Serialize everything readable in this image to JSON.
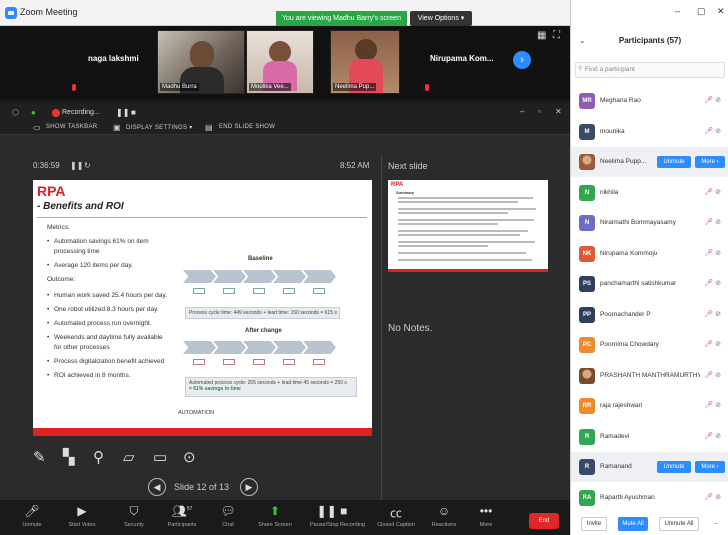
{
  "window": {
    "title": "Zoom Meeting"
  },
  "banner": {
    "sharing_text": "You are viewing Madhu Barry's screen",
    "view_options": "View Options ▾"
  },
  "strip": {
    "tiles": [
      {
        "name": "naga lakshmi"
      },
      {
        "name": "Madhu Burra"
      },
      {
        "name": "Moulika Vee..."
      },
      {
        "name": "Neelima Pup..."
      },
      {
        "name": "Nirupama Kom..."
      }
    ]
  },
  "sharebar": {
    "recording": "Recording...",
    "show_taskbar": "SHOW TASKBAR",
    "display_settings": "DISPLAY SETTINGS ▾",
    "end_slideshow": "END SLIDE SHOW"
  },
  "presenter": {
    "timer": "0:36:59",
    "clock": "8:52 AM",
    "next_slide_label": "Next slide",
    "no_notes": "No Notes.",
    "slide_counter": "Slide 12 of 13"
  },
  "slide": {
    "title": "RPA",
    "subtitle": "- Benefits and ROI",
    "metrics_label": "Metrics:",
    "metrics": [
      "Automation savings 61% on item",
      "processing time",
      "Average 120 items per day."
    ],
    "outcome_label": "Outcome:",
    "outcomes": [
      "Human work saved 25.4 hours per day.",
      "One robot utilized 8.3 hours per day.",
      "Automated process run overnight.",
      "Weekends and daytime fully available",
      "for other processes",
      "Process digitalization benefit achieved",
      "ROI achieved in 8 months."
    ],
    "baseline_title": "Baseline",
    "after_title": "After change",
    "baseline_box": "Process cycle time: 449 seconds + lead time: 150 seconds = 615 s",
    "after_box_1": "Automated process cycle: 205 seconds + lead time 45 seconds = 250 s",
    "after_box_2": "= 61% savings in time",
    "step_label": "Activity",
    "automation": "AUTOMATION"
  },
  "next_slide": {
    "title": "RPA",
    "heading": "Summary"
  },
  "toolbar": {
    "items": [
      {
        "icon": "mic",
        "label": "Unmute"
      },
      {
        "icon": "video",
        "label": "Start Video"
      },
      {
        "icon": "security",
        "label": "Security"
      },
      {
        "icon": "participants",
        "label": "Participants"
      },
      {
        "icon": "chat",
        "label": "Chat"
      },
      {
        "icon": "share",
        "label": "Share Screen"
      },
      {
        "icon": "record",
        "label": "Pause/Stop Recording"
      },
      {
        "icon": "cc",
        "label": "Closed Caption"
      },
      {
        "icon": "reactions",
        "label": "Reactions"
      },
      {
        "icon": "more",
        "label": "More"
      }
    ],
    "participants_count": "57",
    "end": "End"
  },
  "participants": {
    "header": "Participants (57)",
    "search_placeholder": "Find a participant",
    "list": [
      {
        "initials": "MR",
        "name": "Meghana Rao",
        "color": "#8e5bb5"
      },
      {
        "initials": "M",
        "name": "mounika",
        "color": "#3a4a6b"
      },
      {
        "initials": "",
        "name": "Neelima Pupp...",
        "color": "#9b5a3a",
        "photo": true,
        "unmute": "Unmute",
        "more": "More ›"
      },
      {
        "initials": "N",
        "name": "nikhila",
        "color": "#2fa84f"
      },
      {
        "initials": "N",
        "name": "Niraimathi Bommayasamy",
        "color": "#6a6fc4"
      },
      {
        "initials": "NK",
        "name": "Nirupama Kommoju",
        "color": "#e05a3a"
      },
      {
        "initials": "PS",
        "name": "panchamarthi satishkumar",
        "color": "#2f3f5f"
      },
      {
        "initials": "PP",
        "name": "Poornachander P",
        "color": "#2f3f5f"
      },
      {
        "initials": "PC",
        "name": "Poornima Chowdary",
        "color": "#f0892a"
      },
      {
        "initials": "",
        "name": "PRASHANTH MANTHRAMURTHY",
        "color": "#7a4a2a",
        "photo": true
      },
      {
        "initials": "RR",
        "name": "raja rajeshwari",
        "color": "#f0892a"
      },
      {
        "initials": "R",
        "name": "Ramadevi",
        "color": "#2fa84f"
      },
      {
        "initials": "R",
        "name": "Ramanand",
        "color": "#3a4a6b",
        "unmute": "Unmute",
        "more": "More ›"
      },
      {
        "initials": "RA",
        "name": "Rapartti Ayushman",
        "color": "#2fa84f"
      }
    ],
    "invite": "Invite",
    "mute_all": "Mute All",
    "unmute_all": "Unmute All",
    "more_dots": "..."
  },
  "colors": {
    "accent": "#2d8cff",
    "danger": "#e02828",
    "share_green": "#28a745",
    "slide_red": "#d22222"
  }
}
